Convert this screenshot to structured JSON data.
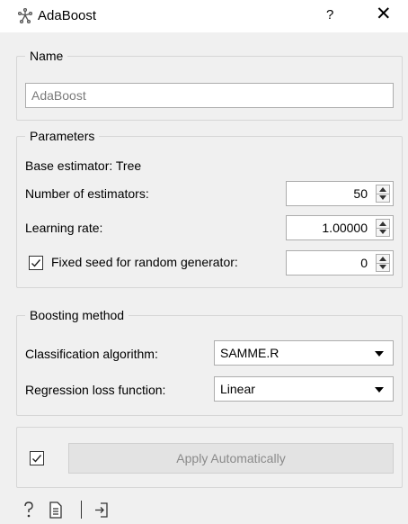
{
  "window": {
    "title": "AdaBoost",
    "help": "?",
    "close": "✕"
  },
  "name_group": {
    "legend": "Name",
    "value": "AdaBoost"
  },
  "parameters_group": {
    "legend": "Parameters",
    "base_estimator": "Base estimator: Tree",
    "n_estimators_label": "Number of estimators:",
    "n_estimators_value": "50",
    "learning_rate_label": "Learning rate:",
    "learning_rate_value": "1.00000",
    "fixed_seed_label": "Fixed seed for random generator:",
    "fixed_seed_checked": true,
    "fixed_seed_value": "0"
  },
  "boosting_group": {
    "legend": "Boosting method",
    "classification_label": "Classification algorithm:",
    "classification_value": "SAMME.R",
    "regression_label": "Regression loss function:",
    "regression_value": "Linear"
  },
  "apply": {
    "auto_checked": true,
    "label": "Apply Automatically"
  },
  "statusbar": {
    "icons": [
      "help-icon",
      "report-icon",
      "output-icon"
    ]
  },
  "colors": {
    "background": "#f0f0f0",
    "titlebar": "#ffffff",
    "group_border": "#d6d6d6",
    "disabled_text": "#8a8a8a"
  }
}
